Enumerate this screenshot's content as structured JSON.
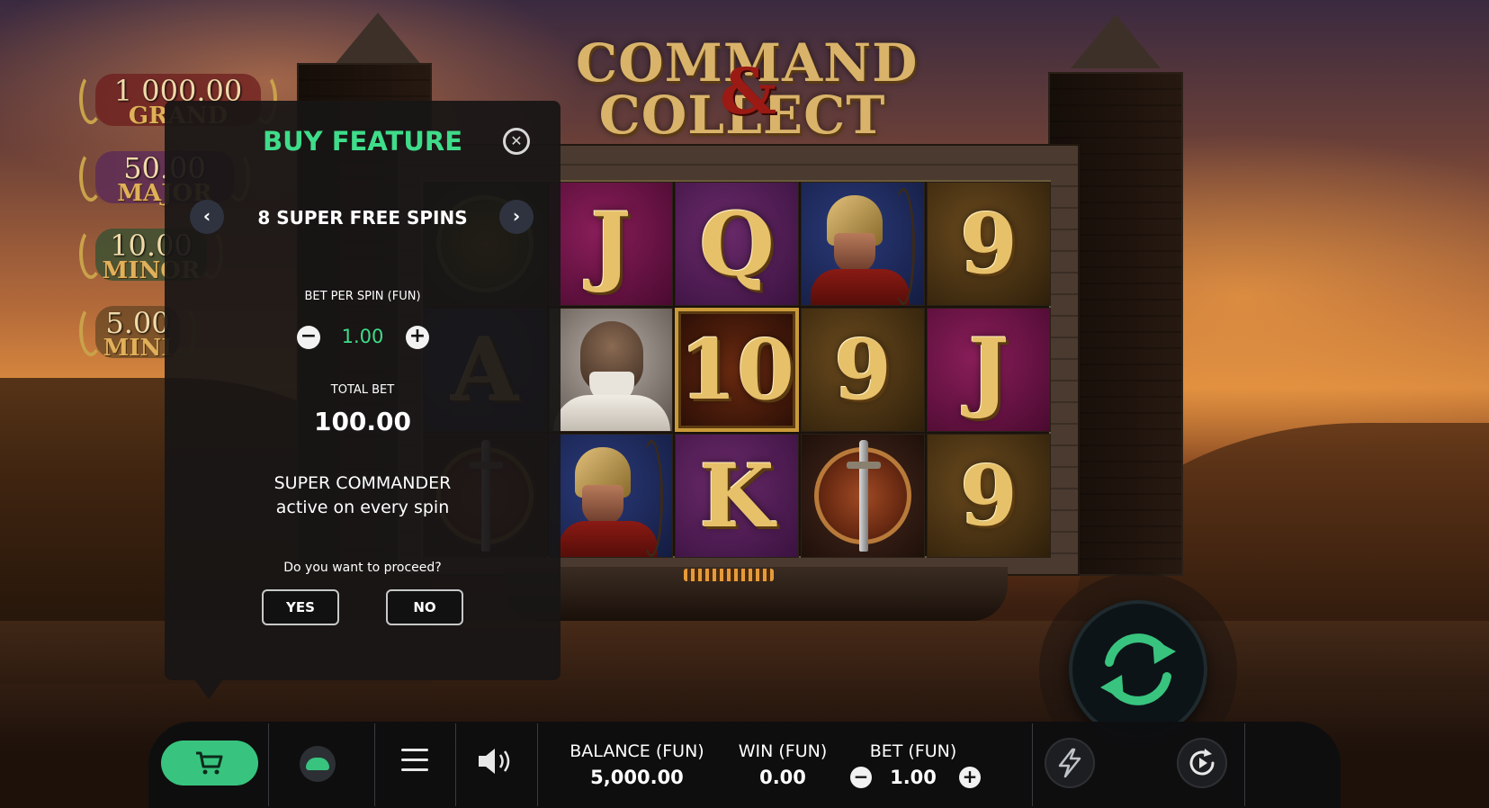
{
  "game": {
    "logo_line1": "COMMAND",
    "logo_amp": "&",
    "logo_line2": "COLLECT"
  },
  "jackpots": [
    {
      "amount": "1 000.00",
      "label": "GRAND"
    },
    {
      "amount": "50.00",
      "label": "MAJOR"
    },
    {
      "amount": "10.00",
      "label": "MINOR"
    },
    {
      "amount": "5.00",
      "label": "MINI"
    }
  ],
  "reels": {
    "grid": [
      [
        "wheat-shield",
        "J",
        "Q",
        "archer-warrior",
        "9"
      ],
      [
        "A",
        "praying-monk",
        "10",
        "9",
        "J"
      ],
      [
        "sword-shield",
        "archer-warrior",
        "K",
        "sword-shield",
        "9"
      ]
    ]
  },
  "buy_feature": {
    "title": "BUY FEATURE",
    "close_glyph": "✕",
    "prev_glyph": "‹",
    "next_glyph": "›",
    "feature_name": "8 SUPER FREE SPINS",
    "bet_per_spin_label": "BET PER SPIN (FUN)",
    "bet_per_spin_value": "1.00",
    "minus_glyph": "−",
    "plus_glyph": "+",
    "total_bet_label": "TOTAL BET",
    "total_bet_value": "100.00",
    "description_line1": "SUPER COMMANDER",
    "description_line2": "active on every spin",
    "proceed_question": "Do you want to proceed?",
    "yes_label": "YES",
    "no_label": "NO"
  },
  "bottom_bar": {
    "balance_label": "BALANCE (FUN)",
    "balance_value": "5,000.00",
    "win_label": "WIN (FUN)",
    "win_value": "0.00",
    "bet_label": "BET (FUN)",
    "bet_value": "1.00",
    "minus_glyph": "−",
    "plus_glyph": "+"
  },
  "icons": {
    "cart": "cart-icon",
    "autoplay": "autoplay-toggle-icon",
    "menu": "menu-icon",
    "sound": "speaker-icon",
    "spin": "spin-arrows-icon",
    "turbo": "lightning-icon",
    "replay": "replay-icon"
  },
  "colors": {
    "accent_green": "#3fdc8a",
    "cart_green": "#38c47e",
    "panel_bg": "#181616"
  }
}
